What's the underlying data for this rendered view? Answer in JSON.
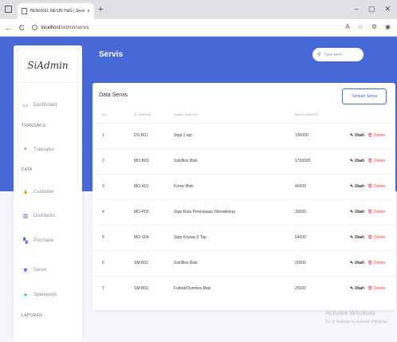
{
  "browser": {
    "tab_title": "BENGKEL MESIN H&G | Servis",
    "tab_close": "×",
    "new_tab": "+",
    "url_host": "localhost",
    "url_path": "/sidmin/servis",
    "minimize": "–",
    "maximize": "▢",
    "close": "✕",
    "back": "←",
    "reload": "C"
  },
  "sidebar": {
    "logo": "SiAdmin",
    "dashboard": "Dashboard",
    "section_transaksi": "TRANSAKSI",
    "transaksi": "Transaksi",
    "section_data": "DATA",
    "customer": "Customer",
    "distributor": "Distributor",
    "purchase": "Purchase",
    "servis": "Servis",
    "spareparts": "Spareparts",
    "section_laporan": "LAPORAN"
  },
  "header": {
    "title": "Servis",
    "search_placeholder": "Type here..."
  },
  "card": {
    "title": "Data Servis",
    "add_button": "Tambah Servis",
    "columns": [
      "NO.",
      "ID SERVIS",
      "NAMA SERVIS",
      "BIAYA SERVIS"
    ],
    "edit_label": "Ubah",
    "delete_label": "Delete",
    "rows": [
      {
        "no": "1",
        "id": "DS-B01",
        "name": "Stpp 1 tap",
        "price": "100000"
      },
      {
        "no": "2",
        "id": "MO-B02",
        "name": "Sok/Bos Blok",
        "price": "1700000"
      },
      {
        "no": "3",
        "id": "MO-K01",
        "name": "Korter Blok",
        "price": "40000"
      },
      {
        "no": "4",
        "id": "MO-P05",
        "name": "Stpp Rata Permukaan Silenderkop",
        "price": "30000"
      },
      {
        "no": "5",
        "id": "MO-S04",
        "name": "Stpp Krukas 9 Tap",
        "price": "54000"
      },
      {
        "no": "6",
        "id": "SM-B02",
        "name": "Sok/Bos Blok",
        "price": "20000"
      },
      {
        "no": "7",
        "id": "SM-B03",
        "name": "Fulbok/Overbos Blok",
        "price": "25000"
      }
    ]
  },
  "watermark": {
    "title": "Activate Windows",
    "subtitle": "Go to Settings to activate Windows."
  },
  "colors": {
    "brand": "#4668d6",
    "delete": "#e74c3c"
  }
}
